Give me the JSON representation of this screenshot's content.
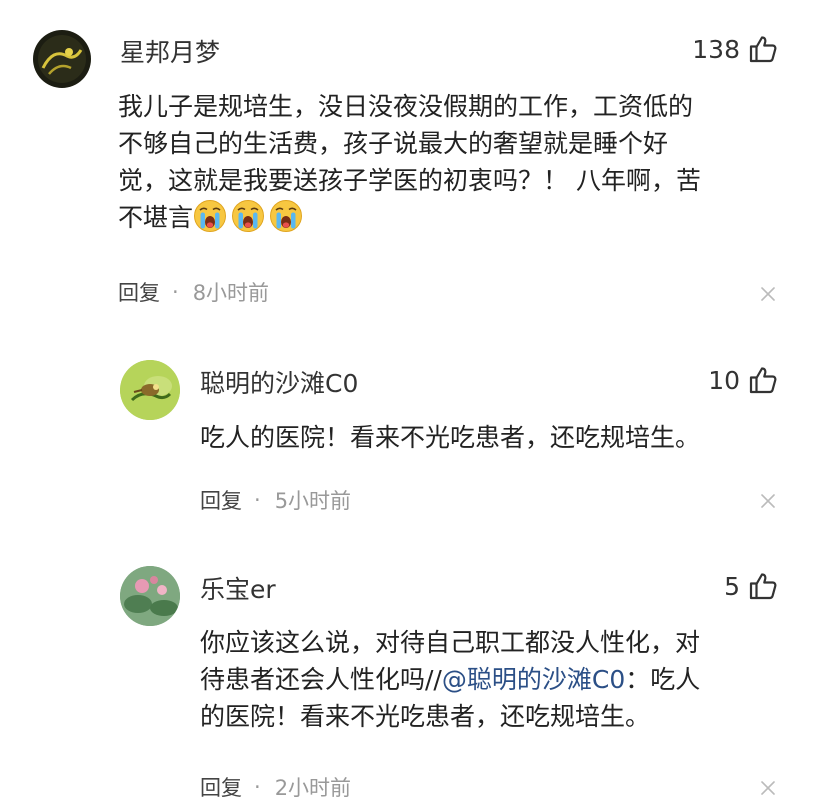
{
  "comments": [
    {
      "username": "星邦月梦",
      "likes": "138",
      "lines": [
        "我儿子是规培生，没日没夜没假期的工作，工资低的",
        "不够自己的生活费，孩子说最大的奢望就是睡个好",
        "觉，这就是我要送孩子学医的初衷吗？！ 八年啊，苦",
        "不堪言"
      ],
      "emoji": [
        "crying-face-emoji",
        "crying-face-emoji",
        "crying-face-emoji"
      ],
      "reply_label": "回复",
      "separator": "·",
      "time": "8小时前",
      "icons": {
        "like": "thumbs-up-icon",
        "close": "close-icon"
      }
    },
    {
      "username": "聪明的沙滩C0",
      "likes": "10",
      "lines": [
        "吃人的医院！看来不光吃患者，还吃规培生。"
      ],
      "reply_label": "回复",
      "separator": "·",
      "time": "5小时前",
      "icons": {
        "like": "thumbs-up-icon",
        "close": "close-icon"
      }
    },
    {
      "username": "乐宝er",
      "likes": "5",
      "line1": "你应该这么说，对待自己职工都没人性化，对",
      "line2_prefix": "待患者还会人性化吗//",
      "line2_mention": "@聪明的沙滩C0",
      "line2_suffix": "：吃人",
      "line3": "的医院！看来不光吃患者，还吃规培生。",
      "reply_label": "回复",
      "separator": "·",
      "time": "2小时前",
      "icons": {
        "like": "thumbs-up-icon",
        "close": "close-icon"
      }
    }
  ],
  "colors": {
    "text": "#222222",
    "muted": "#999999",
    "mention": "#2b4f86"
  }
}
